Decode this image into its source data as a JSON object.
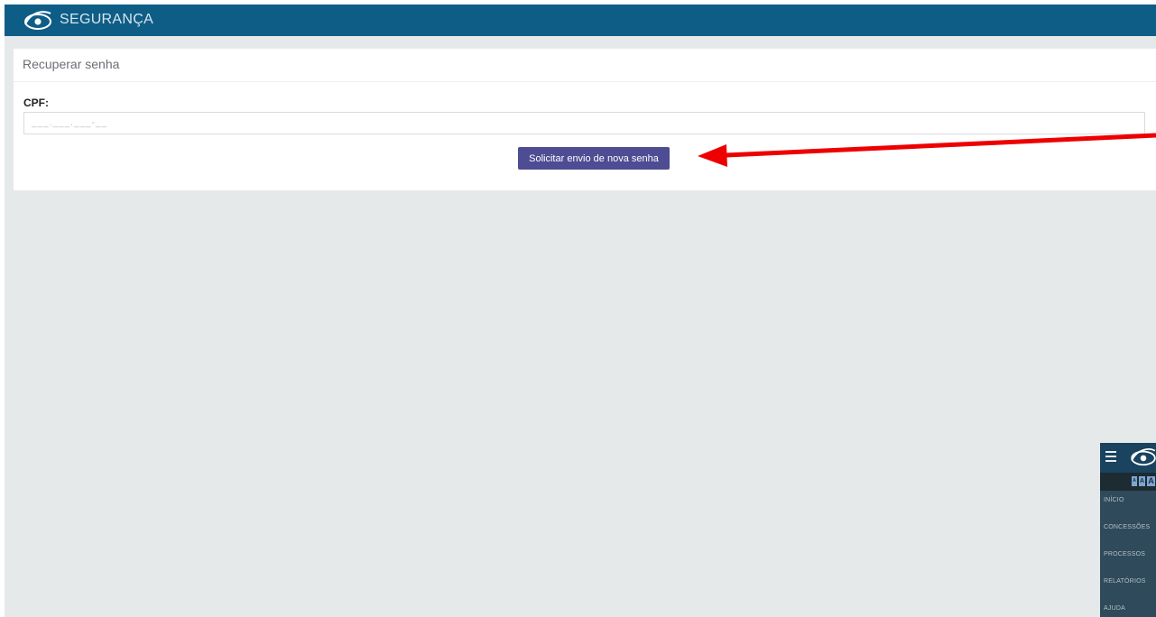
{
  "header": {
    "title": "SEGURANÇA",
    "brand_color": "#0e5d86",
    "logo_icon": "eye-logo-icon"
  },
  "recover_card": {
    "title": "Recuperar senha",
    "cpf_label": "CPF:",
    "cpf_placeholder": "___.___.___-__",
    "submit_label": "Solicitar envio de nova senha",
    "button_color": "#4e4c93"
  },
  "annotation": {
    "arrow_color": "#ee0000",
    "arrow_icon": "red-arrow-pointing-at-button"
  },
  "side_nav": {
    "menu_icon": "hamburger-icon",
    "logo_icon": "eye-logo-icon",
    "font_sizes": [
      "A",
      "A",
      "A"
    ],
    "items": [
      "INÍCIO",
      "CONCESSÕES",
      "PROCESSOS",
      "RELATÓRIOS",
      "AJUDA"
    ]
  }
}
